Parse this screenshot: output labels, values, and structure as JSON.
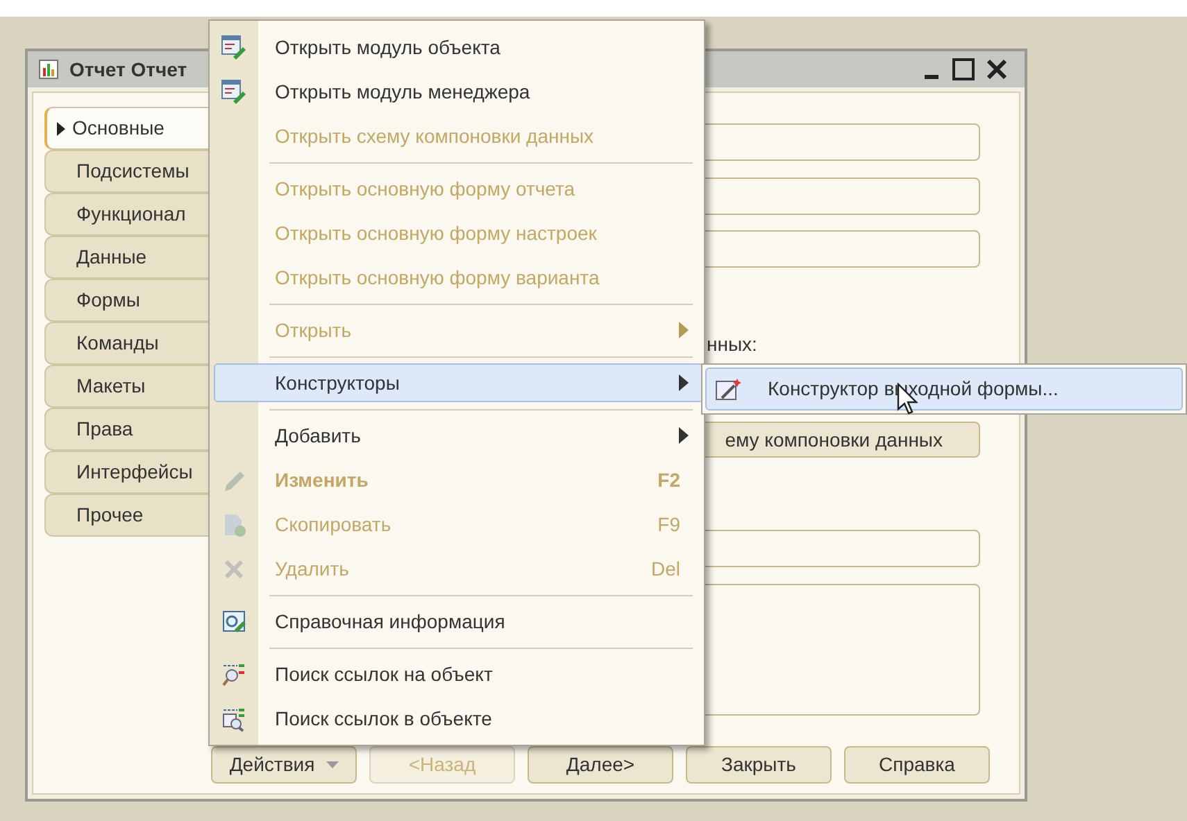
{
  "window": {
    "title": "Отчет Отчет"
  },
  "tabs": [
    {
      "label": "Основные",
      "selected": true
    },
    {
      "label": "Подсистемы",
      "selected": false
    },
    {
      "label": "Функционал",
      "selected": false
    },
    {
      "label": "Данные",
      "selected": false
    },
    {
      "label": "Формы",
      "selected": false
    },
    {
      "label": "Команды",
      "selected": false
    },
    {
      "label": "Макеты",
      "selected": false
    },
    {
      "label": "Права",
      "selected": false
    },
    {
      "label": "Интерфейсы",
      "selected": false
    },
    {
      "label": "Прочее",
      "selected": false
    }
  ],
  "form": {
    "label": "нных:",
    "button": "ему компоновки данных"
  },
  "footer_buttons": [
    {
      "label": "Действия",
      "kind": "dropdown",
      "disabled": false
    },
    {
      "label": "<Назад",
      "kind": "button",
      "disabled": true
    },
    {
      "label": "Далее>",
      "kind": "button",
      "disabled": false
    },
    {
      "label": "Закрыть",
      "kind": "button",
      "disabled": false
    },
    {
      "label": "Справка",
      "kind": "button",
      "disabled": false
    }
  ],
  "context_menu": {
    "items": [
      {
        "kind": "item",
        "label": "Открыть модуль объекта",
        "disabled": false,
        "selected": false,
        "submenu": false,
        "bold": false
      },
      {
        "kind": "item",
        "label": "Открыть модуль менеджера",
        "disabled": false,
        "selected": false,
        "submenu": false,
        "bold": false
      },
      {
        "kind": "item",
        "label": "Открыть схему компоновки данных",
        "disabled": true,
        "selected": false,
        "submenu": false,
        "bold": false
      },
      {
        "kind": "separator"
      },
      {
        "kind": "item",
        "label": "Открыть основную форму отчета",
        "disabled": true,
        "selected": false,
        "submenu": false,
        "bold": false
      },
      {
        "kind": "item",
        "label": "Открыть основную форму настроек",
        "disabled": true,
        "selected": false,
        "submenu": false,
        "bold": false
      },
      {
        "kind": "item",
        "label": "Открыть основную форму варианта",
        "disabled": true,
        "selected": false,
        "submenu": false,
        "bold": false
      },
      {
        "kind": "separator"
      },
      {
        "kind": "item",
        "label": "Открыть",
        "disabled": true,
        "selected": false,
        "submenu": true,
        "bold": false
      },
      {
        "kind": "separator"
      },
      {
        "kind": "item",
        "label": "Конструкторы",
        "disabled": false,
        "selected": true,
        "submenu": true,
        "bold": false
      },
      {
        "kind": "separator"
      },
      {
        "kind": "item",
        "label": "Добавить",
        "disabled": false,
        "selected": false,
        "submenu": true,
        "bold": false
      },
      {
        "kind": "item",
        "label": "Изменить",
        "disabled": true,
        "selected": false,
        "submenu": false,
        "bold": true,
        "shortcut": "F2"
      },
      {
        "kind": "item",
        "label": "Скопировать",
        "disabled": true,
        "selected": false,
        "submenu": false,
        "bold": false,
        "shortcut": "F9"
      },
      {
        "kind": "item",
        "label": "Удалить",
        "disabled": true,
        "selected": false,
        "submenu": false,
        "bold": false,
        "shortcut": "Del"
      },
      {
        "kind": "separator"
      },
      {
        "kind": "item",
        "label": "Справочная информация",
        "disabled": false,
        "selected": false,
        "submenu": false,
        "bold": false
      },
      {
        "kind": "separator"
      },
      {
        "kind": "item",
        "label": "Поиск ссылок на объект",
        "disabled": false,
        "selected": false,
        "submenu": false,
        "bold": false
      },
      {
        "kind": "item",
        "label": "Поиск ссылок в объекте",
        "disabled": false,
        "selected": false,
        "submenu": false,
        "bold": false
      }
    ]
  },
  "submenu": {
    "items": [
      {
        "label": "Конструктор выходной формы...",
        "selected": true
      }
    ]
  }
}
